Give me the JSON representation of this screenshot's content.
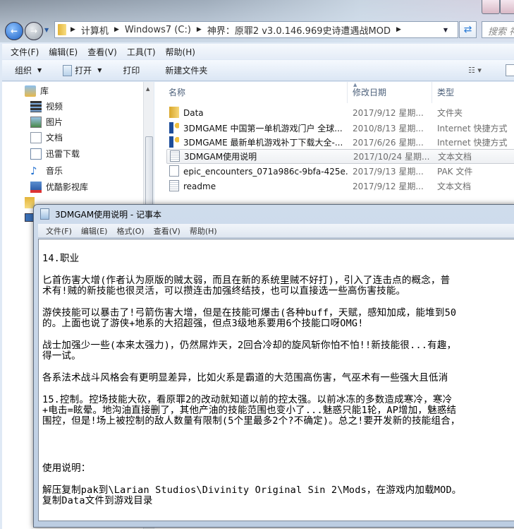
{
  "explorer": {
    "breadcrumb": [
      "计算机",
      "Windows7 (C:)",
      "神界：原罪2 v3.0.146.969史诗遭遇战MOD"
    ],
    "search_placeholder": "搜索 神",
    "menu": [
      "文件(F)",
      "编辑(E)",
      "查看(V)",
      "工具(T)",
      "帮助(H)"
    ],
    "toolbar": {
      "organize": "组织",
      "open": "打开",
      "print": "打印",
      "new_folder": "新建文件夹"
    },
    "nav": [
      {
        "label": "库",
        "icon": "library-icon"
      },
      {
        "label": "视频",
        "icon": "video-icon"
      },
      {
        "label": "图片",
        "icon": "pictures-icon"
      },
      {
        "label": "文档",
        "icon": "documents-icon"
      },
      {
        "label": "迅雷下载",
        "icon": "download-icon"
      },
      {
        "label": "音乐",
        "icon": "music-icon"
      },
      {
        "label": "优酷影视库",
        "icon": "youku-icon"
      }
    ],
    "columns": {
      "name": "名称",
      "date": "修改日期",
      "type": "类型"
    },
    "files": [
      {
        "name": "Data",
        "date": "2017/9/12 星期...",
        "type": "文件夹",
        "icon": "folder-icon"
      },
      {
        "name": "3DMGAME 中国第一单机游戏门户 全球...",
        "date": "2010/8/13 星期...",
        "type": "Internet 快捷方式",
        "icon": "shortcut-icon"
      },
      {
        "name": "3DMGAME 最新单机游戏补丁下载大全-...",
        "date": "2017/6/26 星期...",
        "type": "Internet 快捷方式",
        "icon": "shortcut-icon"
      },
      {
        "name": "3DMGAM使用说明",
        "date": "2017/10/24 星期...",
        "type": "文本文档",
        "icon": "text-file-icon",
        "selected": true
      },
      {
        "name": "epic_encounters_071a986c-9bfa-425e...",
        "date": "2017/9/13 星期...",
        "type": "PAK 文件",
        "icon": "file-icon"
      },
      {
        "name": "readme",
        "date": "2017/9/12 星期...",
        "type": "文本文档",
        "icon": "text-file-icon"
      }
    ]
  },
  "notepad": {
    "title": "3DMGAM使用说明 - 记事本",
    "menu": [
      "文件(F)",
      "编辑(E)",
      "格式(O)",
      "查看(V)",
      "帮助(H)"
    ],
    "lines": [
      "14.职业",
      "匕首伤害大增(作者认为原版的贼太弱，而且在新的系统里贼不好打)，引入了连击点的概念，普",
      "术有!贼的新技能也很灵活，可以攒连击加强终结技，也可以直接选一些高伤害技能。",
      "游侠技能可以暴击了!弓箭伤害大增，但是在技能可爆击(各种buff，天赋，感知加成，能堆到50",
      "的。上面也说了游侠+地系的大招超强，但点3级地系要用6个技能口呀OMG!",
      "战士加强少一些(本来太强力)，仍然屌炸天，2回合冷却的旋风斩你怕不怕!!新技能很...有趣，",
      "得一试。",
      "各系法术战斗风格会有更明显差异，比如火系是霸道的大范围高伤害，气巫术有一些强大且低消",
      "15.控制。控场技能大砍，看原罪2的改动就知道以前的控太强。以前冰冻的多数造成寒冷，寒冷",
      "+电击=眩晕。地沟油直接删了，其他产油的技能范围也变小了...魅惑只能1轮，AP增加，魅惑结",
      "围控，但是!场上被控制的敌人数量有限制(5个里最多2个?不确定)。总之!要开发新的技能组合，",
      "使用说明：",
      "解压复制pak到\\Larian Studios\\Divinity Original Sin 2\\Mods，在游戏内加载MOD。",
      "复制Data文件到游戏目录"
    ]
  }
}
